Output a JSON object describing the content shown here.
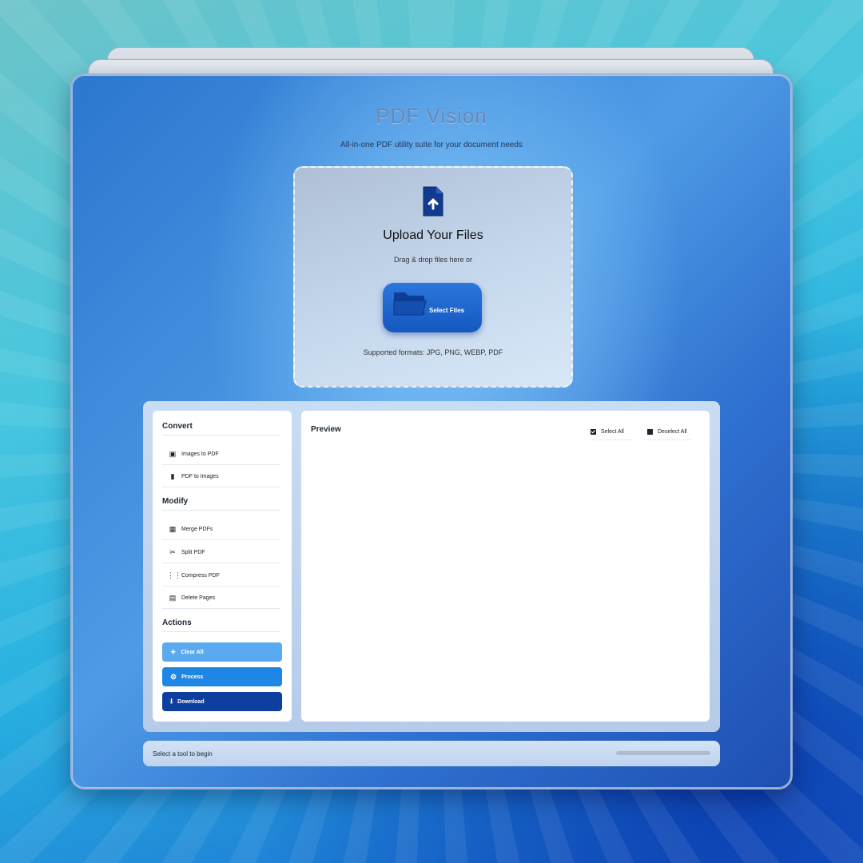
{
  "app": {
    "title": "PDF Vision",
    "subtitle": "All-in-one PDF utility suite for your document needs"
  },
  "upload": {
    "icon": "file-upload-icon",
    "title": "Upload Your Files",
    "hint": "Drag & drop files here or",
    "button_label": "Select Files",
    "button_icon": "folder-icon",
    "formats": "Supported formats: JPG, PNG, WEBP, PDF"
  },
  "sidebar": {
    "convert": {
      "title": "Convert",
      "items": [
        {
          "label": "Images to PDF",
          "icon": "images-icon"
        },
        {
          "label": "PDF to Images",
          "icon": "file-icon"
        }
      ]
    },
    "modify": {
      "title": "Modify",
      "items": [
        {
          "label": "Merge PDFs",
          "icon": "merge-icon"
        },
        {
          "label": "Split PDF",
          "icon": "scissors-icon"
        },
        {
          "label": "Compress PDF",
          "icon": "compress-icon"
        },
        {
          "label": "Delete Pages",
          "icon": "trash-icon"
        }
      ]
    },
    "actions": {
      "title": "Actions",
      "items": [
        {
          "label": "Clear All",
          "icon": "broom-icon",
          "color": "#5aaaf0"
        },
        {
          "label": "Process",
          "icon": "gears-icon",
          "color": "#1f86e6"
        },
        {
          "label": "Download",
          "icon": "download-icon",
          "color": "#0f3f9e"
        }
      ]
    }
  },
  "preview": {
    "title": "Preview",
    "select_all": "Select All",
    "deselect_all": "Deselect All"
  },
  "status": {
    "text": "Select a tool to begin",
    "progress": 0
  },
  "colors": {
    "accent": "#1557c0",
    "background": "#2c77cf"
  }
}
